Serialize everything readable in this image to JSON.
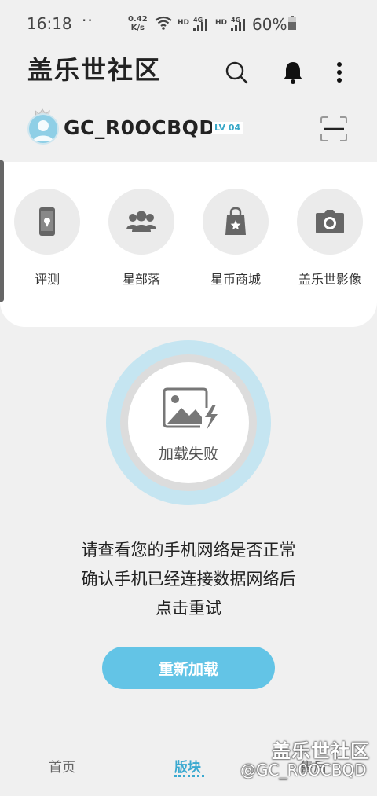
{
  "status_bar": {
    "time": "16:18",
    "dots": "··",
    "speed_value": "0.42",
    "speed_unit": "K/s",
    "hd1": "HD",
    "hd2": "HD",
    "net1": "4G",
    "net2": "4G",
    "battery": "60%"
  },
  "app_bar": {
    "title": "盖乐世社区",
    "icons": [
      "search-icon",
      "bell-icon",
      "more-icon"
    ]
  },
  "user": {
    "name": "GC_R0OCBQD",
    "level": "LV 04"
  },
  "categories": [
    {
      "label": "评测",
      "icon": "phone-icon"
    },
    {
      "label": "星部落",
      "icon": "group-icon"
    },
    {
      "label": "星币商城",
      "icon": "shopping-bag-icon"
    },
    {
      "label": "盖乐世影像",
      "icon": "camera-icon"
    }
  ],
  "load_error": {
    "status": "加载失败",
    "line1": "请查看您的手机网络是否正常",
    "line2": "确认手机已经连接数据网络后",
    "line3": "点击重试",
    "button": "重新加载"
  },
  "bottom_nav": {
    "home": "首页",
    "boards": "版块",
    "after_sales": "售后"
  },
  "watermark": {
    "brand": "盖乐世社区",
    "handle": "@GC_R0OCBQD"
  },
  "colors": {
    "accent": "#63c4e6",
    "nav_active": "#3aa9d0",
    "background": "#f0f0f0"
  }
}
